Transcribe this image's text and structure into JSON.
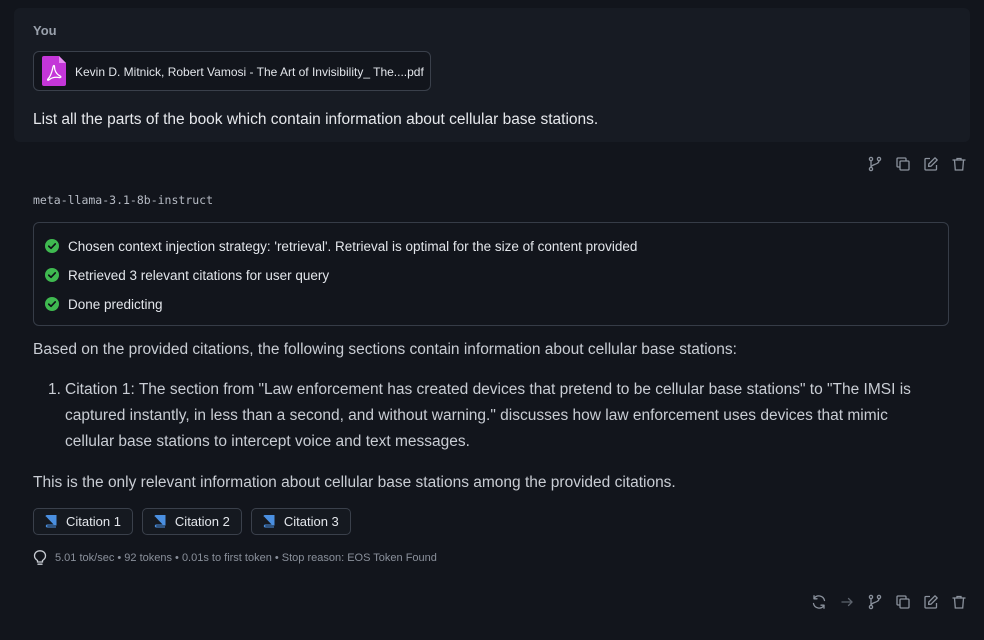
{
  "user_message": {
    "sender": "You",
    "attachment": {
      "icon": "pdf-file-icon",
      "file_name": "Kevin D. Mitnick, Robert Vamosi - The Art of Invisibility_ The....pdf",
      "icon_color": "#c436d8"
    },
    "text": "List all the parts of the book which contain information about cellular base stations."
  },
  "message_actions": {
    "icons": [
      "branch-icon",
      "copy-icon",
      "edit-icon",
      "delete-icon"
    ]
  },
  "assistant_message": {
    "model": "meta-llama-3.1-8b-instruct",
    "status_steps": [
      {
        "icon": "check-circle-icon",
        "text": "Chosen context injection strategy: 'retrieval'. Retrieval is optimal for the size of content provided"
      },
      {
        "icon": "check-circle-icon",
        "text": "Retrieved 3 relevant citations for user query"
      },
      {
        "icon": "check-circle-icon",
        "text": "Done predicting"
      }
    ],
    "intro": "Based on the provided citations, the following sections contain information about cellular base stations:",
    "list_items": [
      {
        "number": "1.",
        "lines": [
          "Citation 1: The section from \"Law enforcement has created devices that pretend to be cellular base stations\" to \"The IMSI is",
          "captured instantly, in less than a second, and without warning.\" discusses how law enforcement uses devices that mimic",
          "cellular base stations to intercept voice and text messages."
        ]
      }
    ],
    "outro": "This is the only relevant information about cellular base stations among the provided citations.",
    "citations": [
      {
        "icon": "book-icon",
        "label": "Citation 1"
      },
      {
        "icon": "book-icon",
        "label": "Citation 2"
      },
      {
        "icon": "book-icon",
        "label": "Citation 3"
      }
    ],
    "stats": {
      "icon": "lightbulb-icon",
      "text": "5.01 tok/sec • 92 tokens • 0.01s to first token • Stop reason: EOS Token Found"
    }
  },
  "assistant_actions": {
    "icons": [
      "regenerate-icon",
      "continue-icon",
      "branch-icon",
      "copy-icon",
      "edit-icon",
      "delete-icon"
    ]
  },
  "colors": {
    "background": "#12151c",
    "user_bubble": "#171b23",
    "success_green": "#3fb950",
    "citation_book_blue": "#4a8fe0",
    "icon_gray": "#8b929d"
  }
}
